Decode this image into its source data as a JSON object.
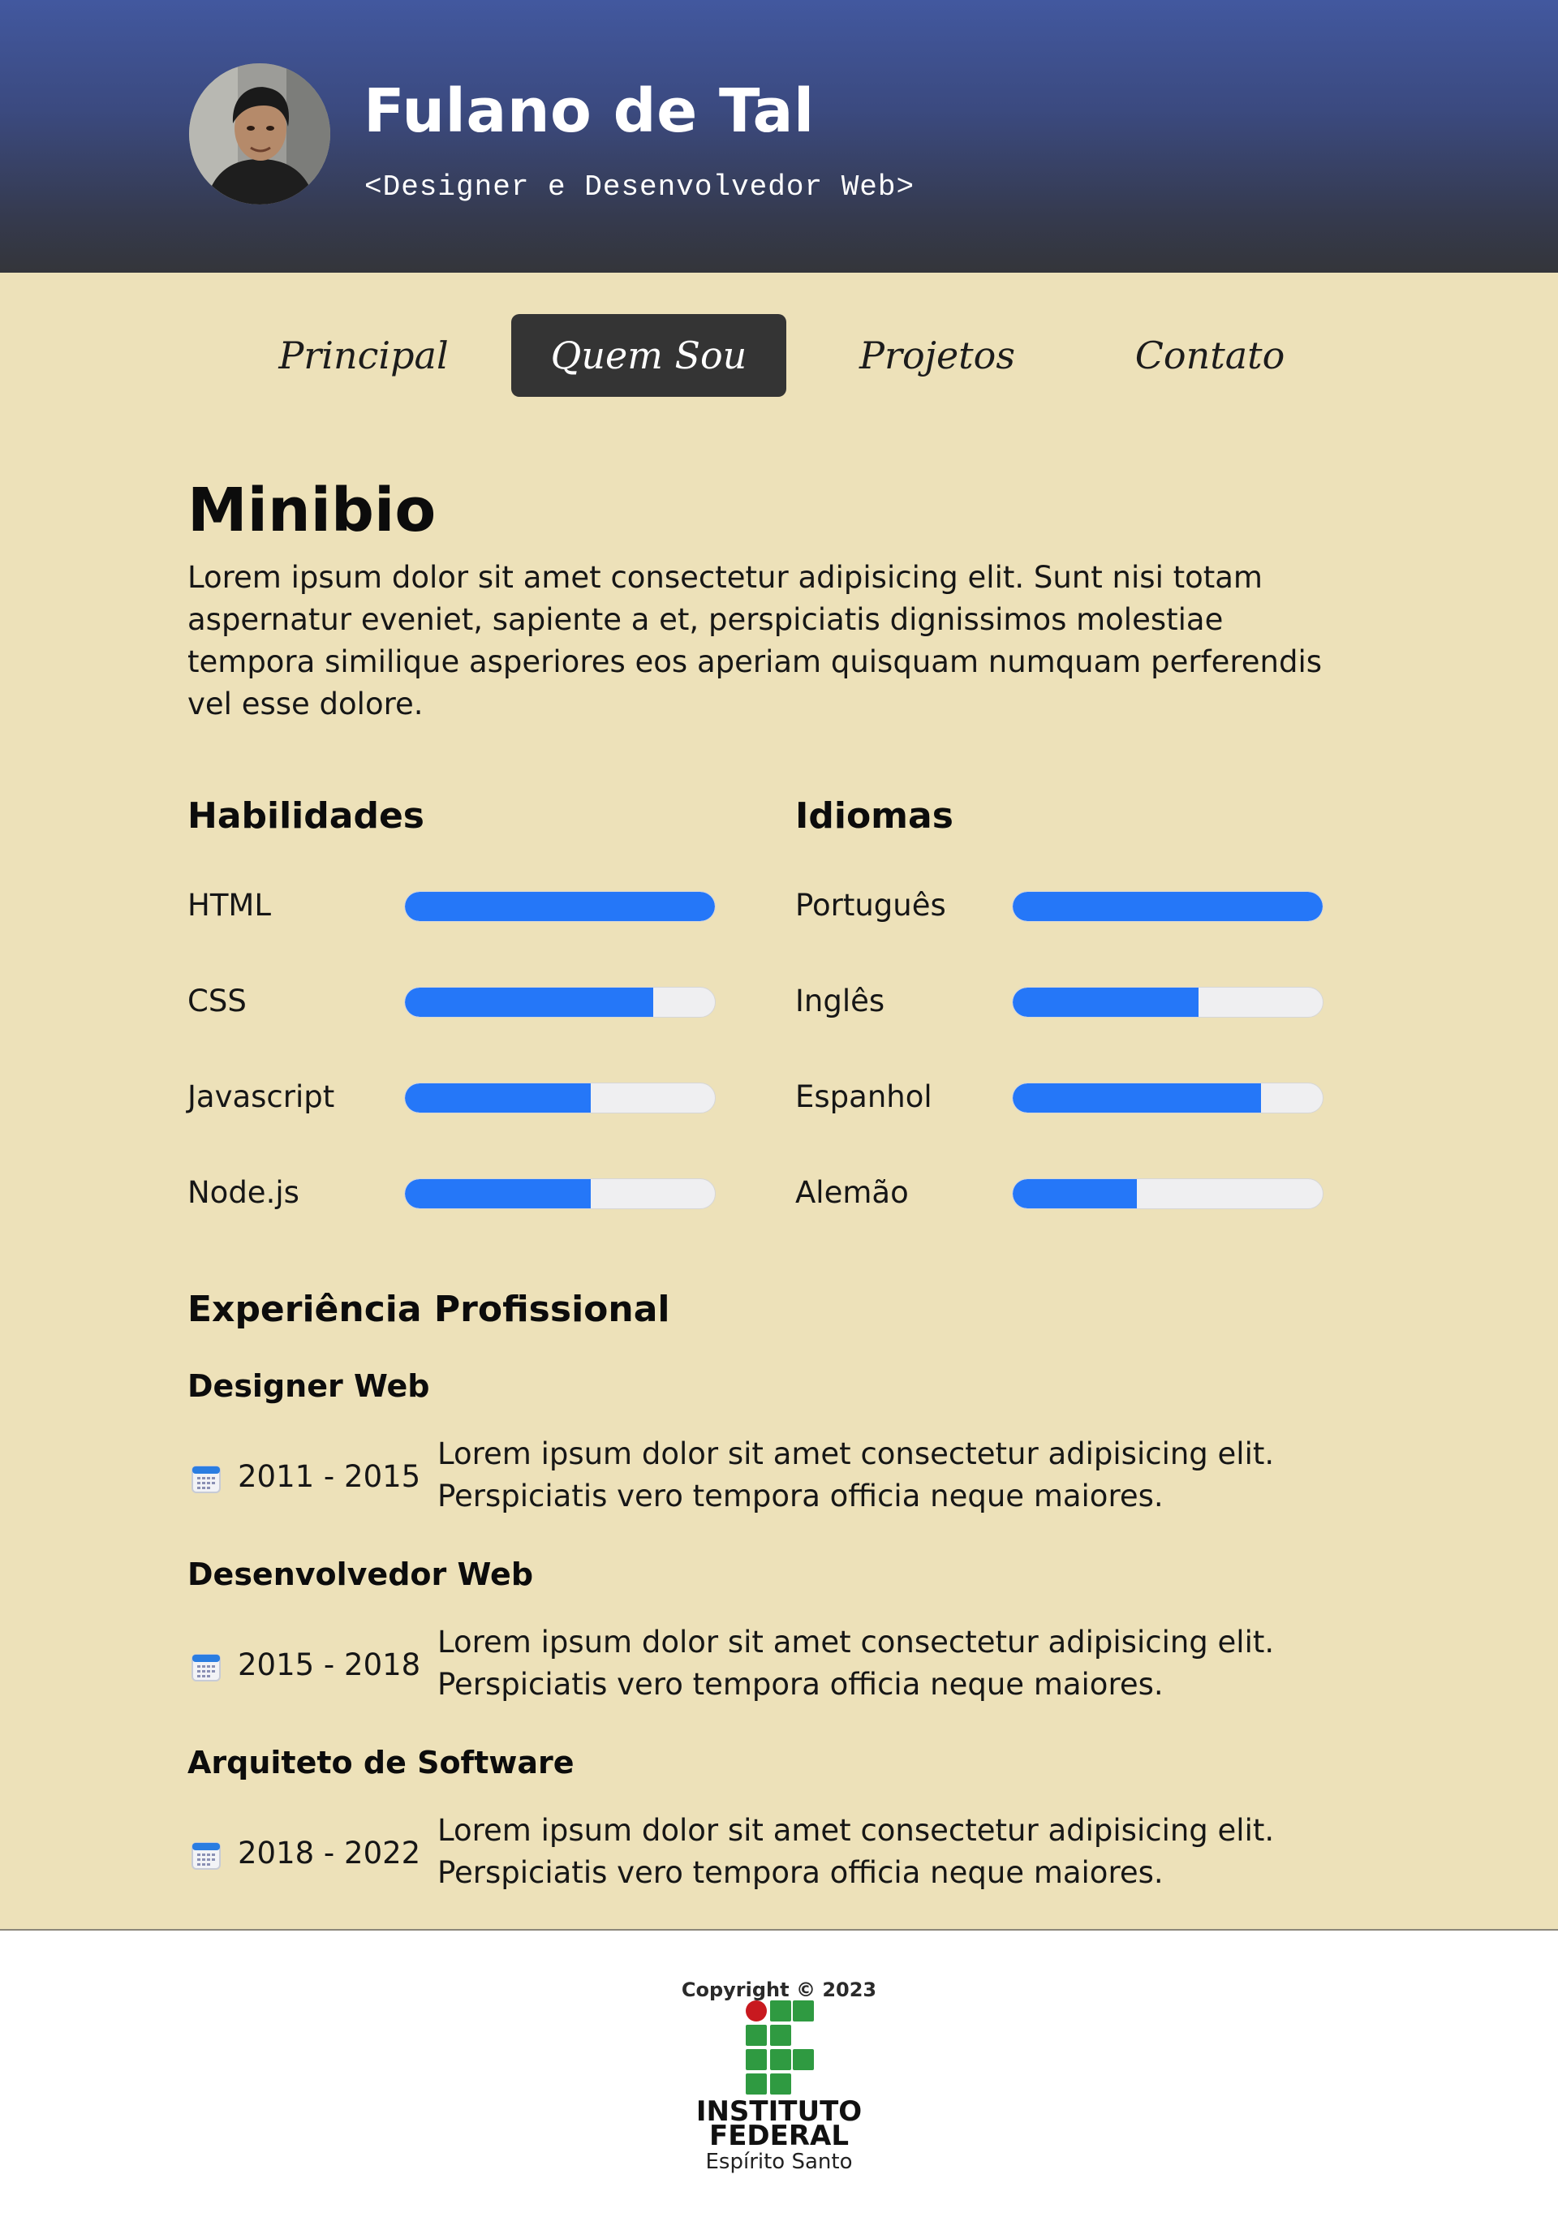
{
  "header": {
    "name": "Fulano de Tal",
    "role": "<Designer e Desenvolvedor Web>"
  },
  "nav": {
    "items": [
      {
        "label": "Principal",
        "active": false
      },
      {
        "label": "Quem Sou",
        "active": true
      },
      {
        "label": "Projetos",
        "active": false
      },
      {
        "label": "Contato",
        "active": false
      }
    ]
  },
  "minibio": {
    "title": "Minibio",
    "text": "Lorem ipsum dolor sit amet consectetur adipisicing elit. Sunt nisi totam aspernatur eveniet, sapiente a et, perspiciatis dignissimos molestiae tempora similique asperiores eos aperiam quisquam numquam perferendis vel esse dolore."
  },
  "skills": {
    "title": "Habilidades",
    "items": [
      {
        "label": "HTML",
        "level": 1.0
      },
      {
        "label": "CSS",
        "level": 0.8
      },
      {
        "label": "Javascript",
        "level": 0.6
      },
      {
        "label": "Node.js",
        "level": 0.6
      }
    ]
  },
  "languages": {
    "title": "Idiomas",
    "items": [
      {
        "label": "Português",
        "level": 1.0
      },
      {
        "label": "Inglês",
        "level": 0.6
      },
      {
        "label": "Espanhol",
        "level": 0.8
      },
      {
        "label": "Alemão",
        "level": 0.4
      }
    ]
  },
  "experience": {
    "title": "Experiência Profissional",
    "jobs": [
      {
        "title": "Designer Web",
        "period": "2011 - 2015",
        "description": "Lorem ipsum dolor sit amet consectetur adipisicing elit. Perspiciatis vero tempora officia neque maiores."
      },
      {
        "title": "Desenvolvedor Web",
        "period": "2015 - 2018",
        "description": "Lorem ipsum dolor sit amet consectetur adipisicing elit. Perspiciatis vero tempora officia neque maiores."
      },
      {
        "title": "Arquiteto de Software",
        "period": "2018 - 2022",
        "description": "Lorem ipsum dolor sit amet consectetur adipisicing elit. Perspiciatis vero tempora officia neque maiores."
      }
    ]
  },
  "footer": {
    "copyright": "Copyright © 2023",
    "logo_line1": "INSTITUTO",
    "logo_line2": "FEDERAL",
    "logo_line3": "Espírito Santo"
  },
  "colors": {
    "accent": "#2577f8",
    "background": "#ede1b9",
    "nav_active": "#343434",
    "logo_green": "#2f9a41",
    "logo_red": "#c8191f"
  },
  "icons": {
    "calendar": "calendar-icon",
    "avatar": "avatar"
  }
}
